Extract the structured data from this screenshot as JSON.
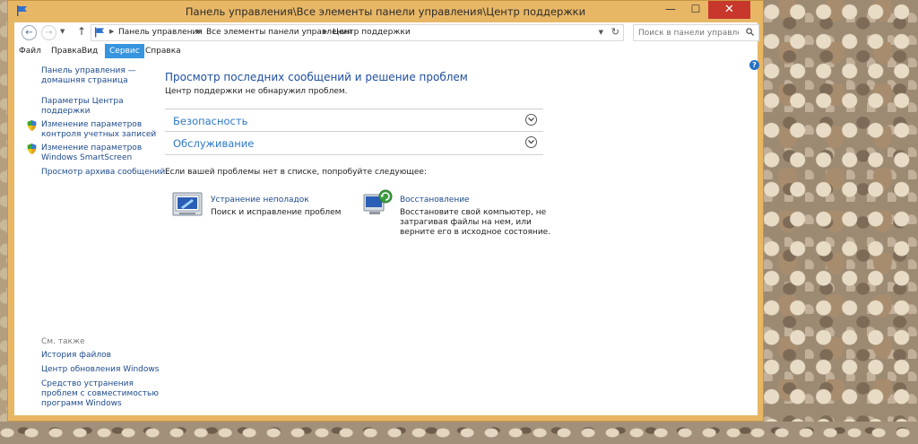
{
  "window": {
    "title": "Панель управления\\Все элементы панели управления\\Центр поддержки",
    "min_label": "—",
    "max_label": "☐",
    "close_label": "✕"
  },
  "navigation": {
    "back_label": "←",
    "forward_label": "→",
    "up_label": "↑",
    "breadcrumbs": [
      "Панель управления",
      "Все элементы панели управления",
      "Центр поддержки"
    ],
    "search_placeholder": "Поиск в панели управления"
  },
  "menu": {
    "items": [
      "Файл",
      "Правка",
      "Вид",
      "Сервис",
      "Справка"
    ],
    "active": "Сервис"
  },
  "sidebar": {
    "home_link": [
      "Панель управления —",
      "домашняя страница"
    ],
    "settings_link": [
      "Параметры Центра",
      "поддержки"
    ],
    "uac_link": [
      "Изменение параметров",
      "контроля учетных записей"
    ],
    "smartscreen_link": [
      "Изменение параметров",
      "Windows SmartScreen"
    ],
    "archive_link": "Просмотр архива сообщений",
    "see_also_label": "См. также",
    "see_also": {
      "file_history": "История файлов",
      "windows_update": "Центр обновления Windows",
      "compat": [
        "Средство устранения",
        "проблем с совместимостью",
        "программ Windows"
      ]
    }
  },
  "main": {
    "title": "Просмотр последних сообщений и решение проблем",
    "status": "Центр поддержки не обнаружил проблем.",
    "sections": [
      "Безопасность",
      "Обслуживание"
    ],
    "try_text": "Если вашей проблемы нет в списке, попробуйте следующее:",
    "troubleshoot": {
      "title": "Устранение неполадок",
      "desc": "Поиск и исправление проблем"
    },
    "recovery": {
      "title": "Восстановление",
      "desc": [
        "Восстановите свой компьютер, не",
        "затрагивая файлы на нем, или",
        "верните его в исходное состояние."
      ]
    }
  },
  "colors": {
    "window_frame": "#e8b766",
    "close_button": "#c7372c",
    "menu_active": "#3795df",
    "link": "#1c4a8c",
    "title": "#1d4e9e",
    "section_label": "#2e78c8"
  },
  "icons": [
    "flag-icon",
    "back-arrow-icon",
    "forward-arrow-icon",
    "up-arrow-icon",
    "refresh-icon",
    "search-icon",
    "shield-icon",
    "help-icon",
    "chevron-down-icon",
    "troubleshoot-icon",
    "recovery-icon"
  ]
}
